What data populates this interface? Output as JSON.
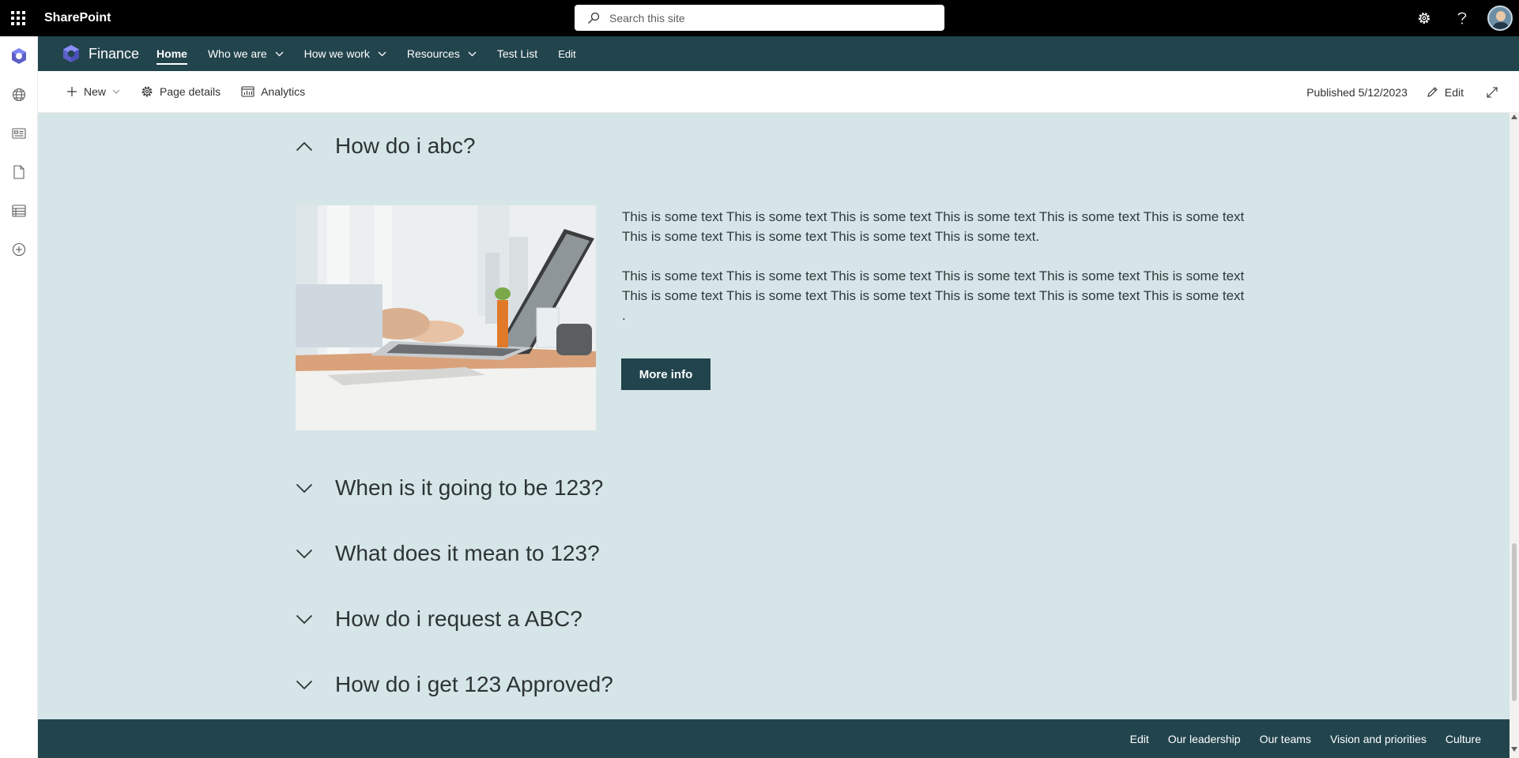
{
  "suite_bar": {
    "brand": "SharePoint",
    "search_placeholder": "Search this site"
  },
  "hub_nav": {
    "site_title": "Finance",
    "items": [
      {
        "label": "Home",
        "dropdown": false,
        "active": true
      },
      {
        "label": "Who we are",
        "dropdown": true
      },
      {
        "label": "How we work",
        "dropdown": true
      },
      {
        "label": "Resources",
        "dropdown": true
      },
      {
        "label": "Test List",
        "dropdown": false
      },
      {
        "label": "Edit",
        "dropdown": false
      }
    ]
  },
  "command_bar": {
    "new_label": "New",
    "page_details_label": "Page details",
    "analytics_label": "Analytics",
    "published": "Published 5/12/2023",
    "edit_label": "Edit"
  },
  "accordion": {
    "expanded": {
      "title": "How do i abc?",
      "paragraph_1": "This is some text This is some text This is some text This is some text This is some text This is some text This is some text This is some text This is some text This is some text.",
      "paragraph_2": "This is some text This is some text This is some text This is some text This is some text This is some text This is some text This is some text This is some text This is some text This is some text This is some text .",
      "button_label": "More info"
    },
    "collapsed": [
      "When is it going to be 123?",
      "What does it mean to 123?",
      "How do i request a ABC?",
      "How do i get 123 Approved?"
    ]
  },
  "footer": {
    "links": [
      "Edit",
      "Our leadership",
      "Our teams",
      "Vision and priorities",
      "Culture"
    ]
  },
  "colors": {
    "suite_bar": "#000000",
    "theme_dark": "#22444d",
    "section_background": "#d5e5e8"
  }
}
